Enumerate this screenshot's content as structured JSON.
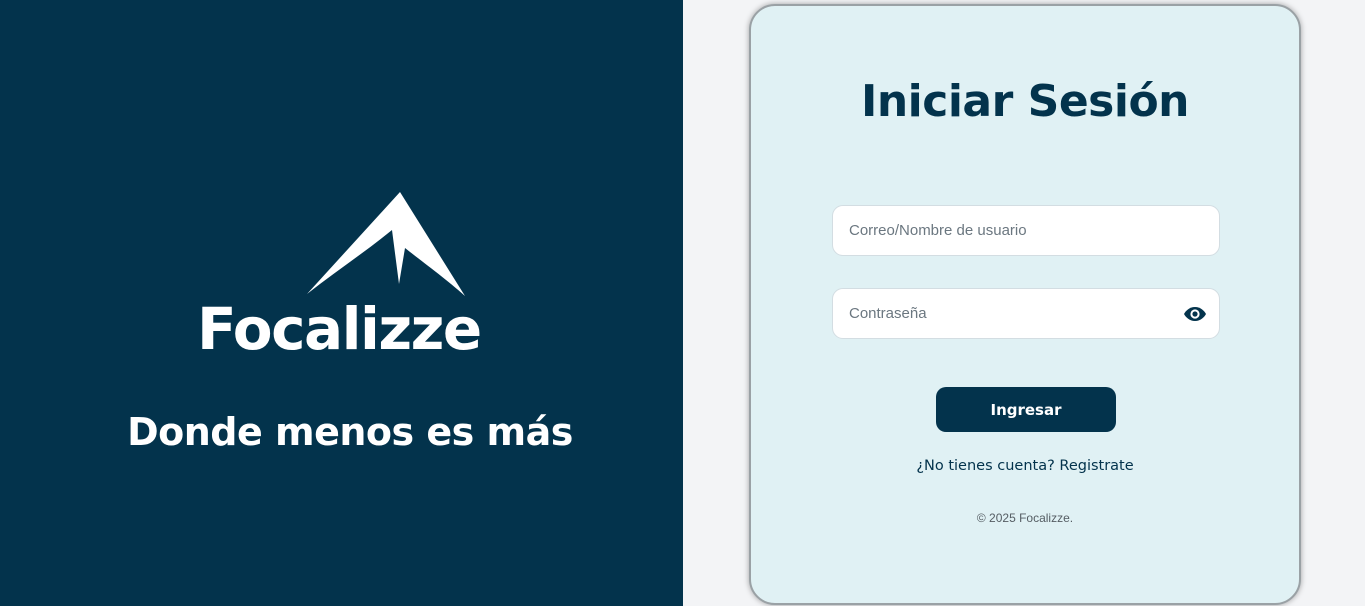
{
  "brand": {
    "name": "Focalizze",
    "tagline": "Donde menos es más",
    "logo_icon": "mountain-icon"
  },
  "login": {
    "title": "Iniciar Sesión",
    "email_placeholder": "Correo/Nombre de usuario",
    "email_value": "",
    "password_placeholder": "Contraseña",
    "password_value": "",
    "toggle_icon": "eye-icon",
    "submit_label": "Ingresar",
    "register_text": "¿No tienes cuenta? Registrate",
    "copyright": "© 2025 Focalizze."
  },
  "colors": {
    "primary": "#03334c",
    "card_background": "#e0f1f4",
    "page_background": "#f3f4f6"
  }
}
